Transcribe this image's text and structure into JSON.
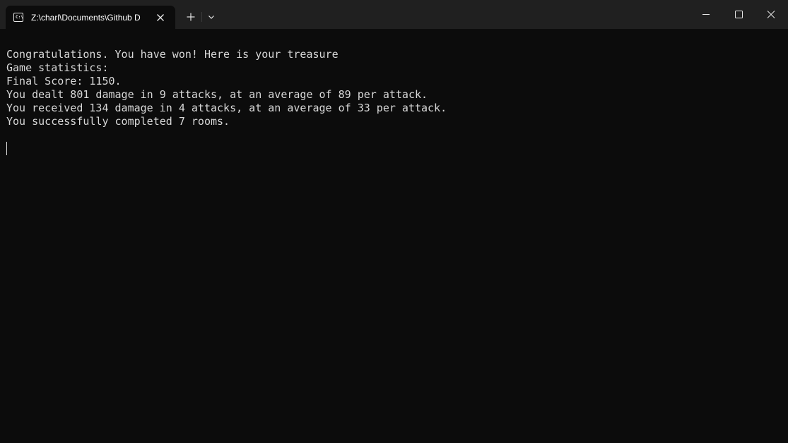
{
  "window": {
    "tab_title": "Z:\\charl\\Documents\\Github D",
    "tab_icon": "terminal-icon",
    "icons": {
      "close_tab": "close-icon",
      "new_tab": "plus-icon",
      "dropdown": "chevron-down-icon",
      "minimize": "minimize-icon",
      "maximize": "maximize-icon",
      "close_window": "close-icon"
    }
  },
  "terminal": {
    "lines": [
      "Congratulations. You have won! Here is your treasure",
      "Game statistics:",
      "Final Score: 1150.",
      "You dealt 801 damage in 9 attacks, at an average of 89 per attack.",
      "You received 134 damage in 4 attacks, at an average of 33 per attack.",
      "You successfully completed 7 rooms."
    ]
  },
  "colors": {
    "background": "#0c0c0c",
    "titlebar": "#202020",
    "text": "#d8d8d8"
  }
}
